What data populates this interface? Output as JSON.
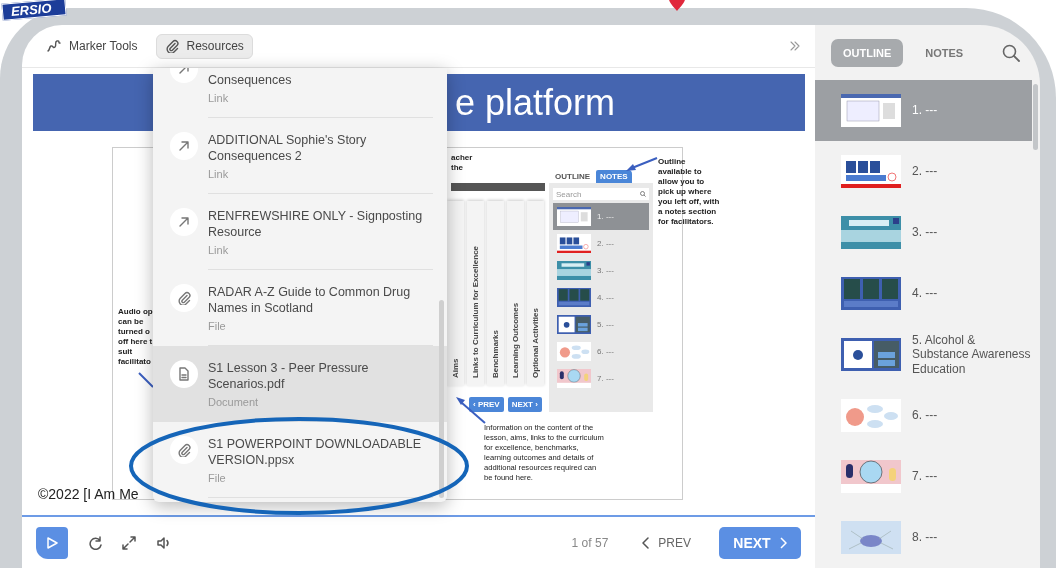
{
  "banner": {
    "text": "ERSIO"
  },
  "toolbar": {
    "tools": [
      {
        "label": "Marker Tools",
        "kind": "marker",
        "selected": false
      },
      {
        "label": "Resources",
        "kind": "clip",
        "selected": true
      }
    ]
  },
  "slide": {
    "title": "e platform",
    "copyright": "©2022 [I Am Me",
    "audio_note": [
      "Audio op",
      "can be",
      "turned o",
      "off here t",
      "suit",
      "facilitato"
    ],
    "teacher_note": [
      "acher",
      "the"
    ],
    "tabs": [
      "Aims",
      "Links to Curriculum for Excellence",
      "Benchmarks",
      "Learning Outcomes",
      "Optional Activities"
    ],
    "prev": "‹ PREV",
    "next": "NEXT ›",
    "outline": {
      "tabs": [
        {
          "label": "OUTLINE",
          "selected": false
        },
        {
          "label": "NOTES",
          "selected": true
        }
      ],
      "search": {
        "placeholder": "Search"
      },
      "items": [
        {
          "label": "1. ---",
          "selected": true
        },
        {
          "label": "2. ---",
          "selected": false
        },
        {
          "label": "3. ---",
          "selected": false
        },
        {
          "label": "4. ---",
          "selected": false
        },
        {
          "label": "5. ---",
          "selected": false
        },
        {
          "label": "6. ---",
          "selected": false
        },
        {
          "label": "7. ---",
          "selected": false
        }
      ]
    },
    "outline_note": "Outline available to allow you to pick up where you left off, with a notes section for facilitators.",
    "info_note": "Information on the content of the lesson, aims, links to the curriculum for excellence, benchmarks, learning outcomes and details of additional resources required can be found here."
  },
  "resources": {
    "items": [
      {
        "title": "Consequences",
        "type": "Link",
        "kind": "link",
        "selected": false
      },
      {
        "title": "ADDITIONAL Sophie's Story Consequences 2",
        "type": "Link",
        "kind": "link",
        "selected": false
      },
      {
        "title": "RENFREWSHIRE ONLY - Signposting Resource",
        "type": "Link",
        "kind": "link",
        "selected": false
      },
      {
        "title": "RADAR A-Z Guide to Common Drug Names in Scotland",
        "type": "File",
        "kind": "file",
        "selected": false
      },
      {
        "title": "S1 Lesson 3 - Peer Pressure Scenarios.pdf",
        "type": "Document",
        "kind": "document",
        "selected": true
      },
      {
        "title": "S1 POWERPOINT DOWNLOADABLE VERSION.ppsx",
        "type": "File",
        "kind": "file",
        "selected": false
      }
    ]
  },
  "player": {
    "counter": "1 of 57",
    "prev": "PREV",
    "next": "NEXT"
  },
  "sidebar": {
    "tabs": [
      {
        "label": "OUTLINE",
        "selected": true
      },
      {
        "label": "NOTES",
        "selected": false
      }
    ],
    "items": [
      {
        "label": "1. ---",
        "selected": true
      },
      {
        "label": "2. ---",
        "selected": false
      },
      {
        "label": "3. ---",
        "selected": false
      },
      {
        "label": "4. ---",
        "selected": false
      },
      {
        "label": "5. Alcohol & Substance Awareness Education",
        "selected": false
      },
      {
        "label": "6. ---",
        "selected": false
      },
      {
        "label": "7. ---",
        "selected": false
      },
      {
        "label": "8. ---",
        "selected": false
      }
    ]
  }
}
